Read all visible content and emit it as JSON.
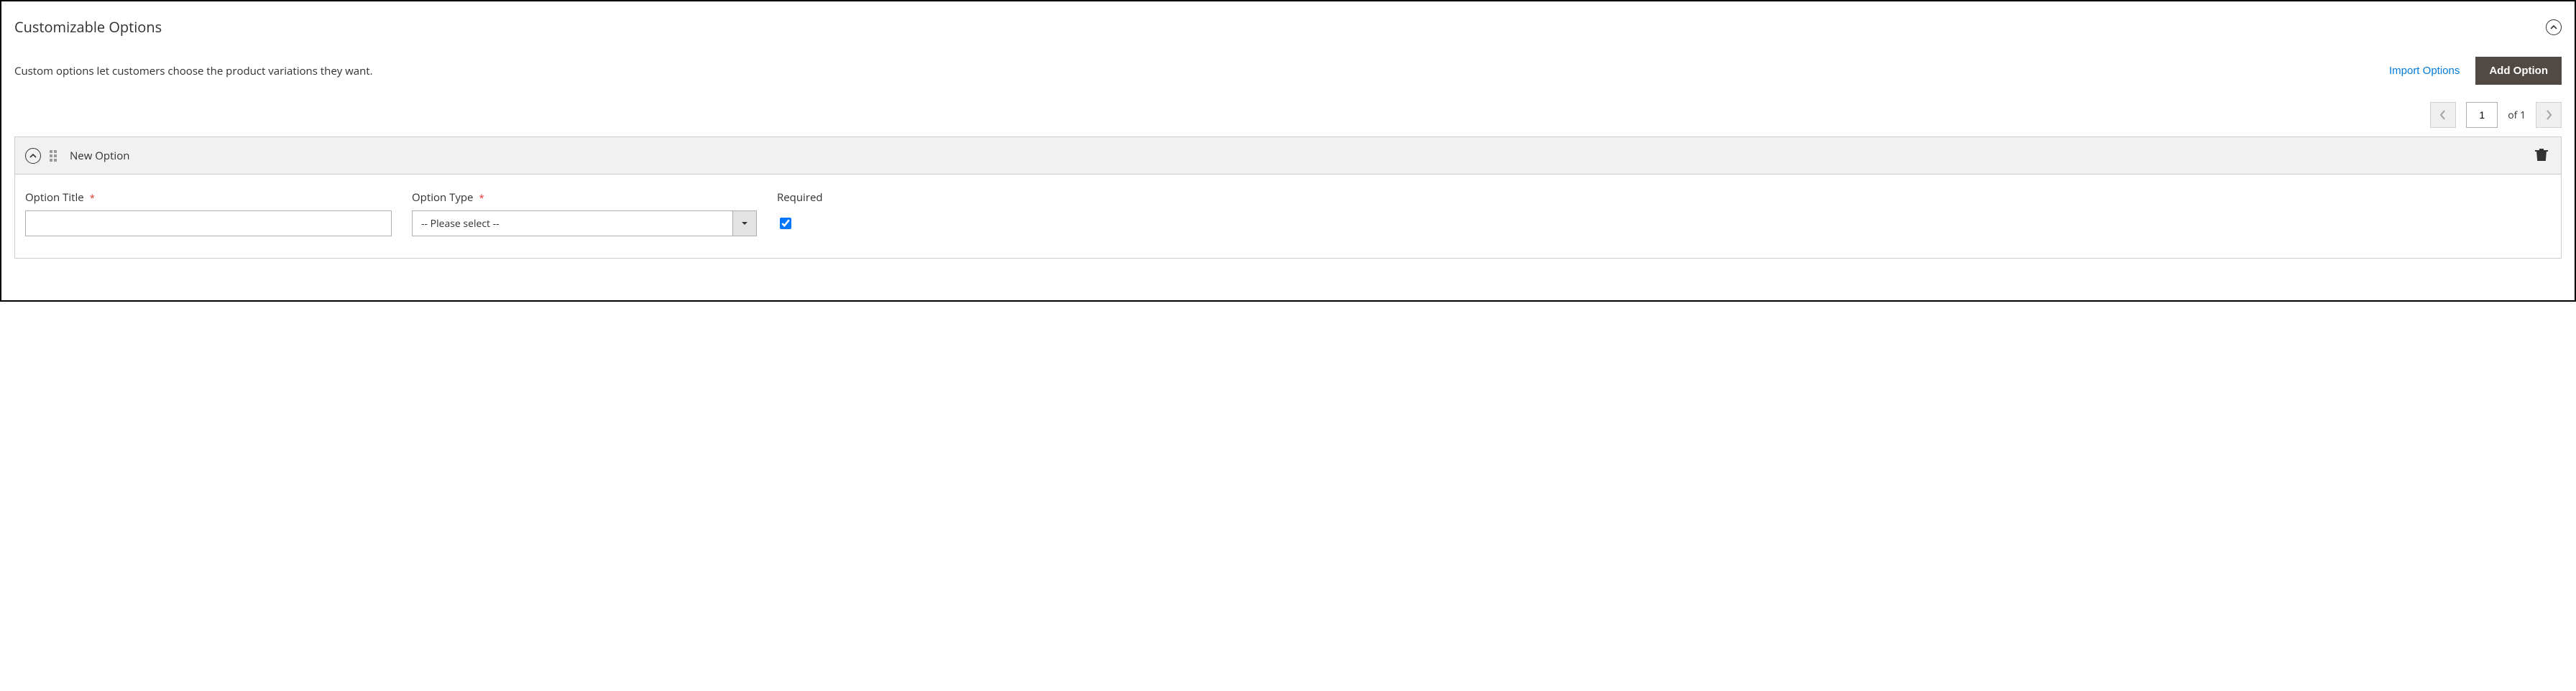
{
  "section": {
    "title": "Customizable Options",
    "description": "Custom options let customers choose the product variations they want."
  },
  "actions": {
    "import": "Import Options",
    "add": "Add Option"
  },
  "pagination": {
    "page": "1",
    "of_label": "of 1"
  },
  "option": {
    "header_name": "New Option",
    "fields": {
      "title_label": "Option Title",
      "title_value": "",
      "type_label": "Option Type",
      "type_selected": "-- Please select --",
      "required_label": "Required",
      "required_checked": true
    }
  }
}
